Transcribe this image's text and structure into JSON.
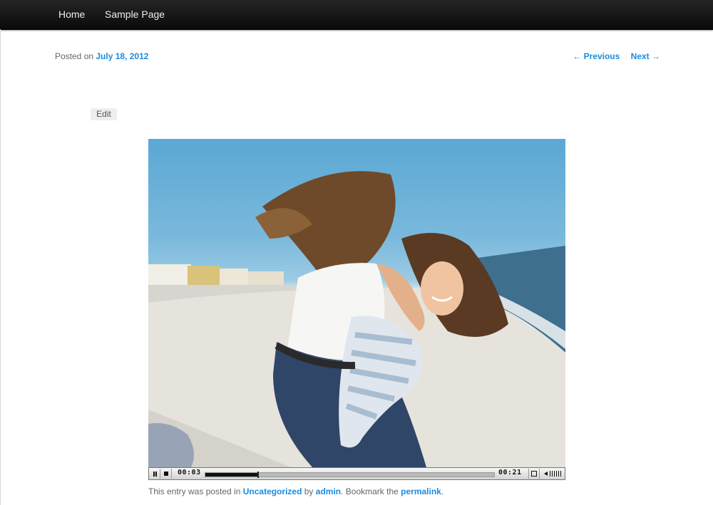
{
  "nav": {
    "items": [
      {
        "label": "Home"
      },
      {
        "label": "Sample Page"
      }
    ]
  },
  "entry": {
    "posted_prefix": "Posted on ",
    "date": "July 18, 2012",
    "edit_label": "Edit"
  },
  "post_nav": {
    "previous": "← Previous",
    "next": "Next →"
  },
  "player": {
    "current_time": "00:03",
    "duration": "00:21",
    "progress_fraction": 0.18,
    "icons": [
      "pause-icon",
      "stop-icon",
      "fullscreen-icon",
      "volume-icon"
    ]
  },
  "footer": {
    "text1": "This entry was posted in ",
    "category": "Uncategorized",
    "text2": " by ",
    "author": "admin",
    "text3": ". Bookmark the ",
    "permalink": "permalink",
    "text4": "."
  },
  "colors": {
    "link": "#1b8be0",
    "nav_bg": "#111111"
  }
}
